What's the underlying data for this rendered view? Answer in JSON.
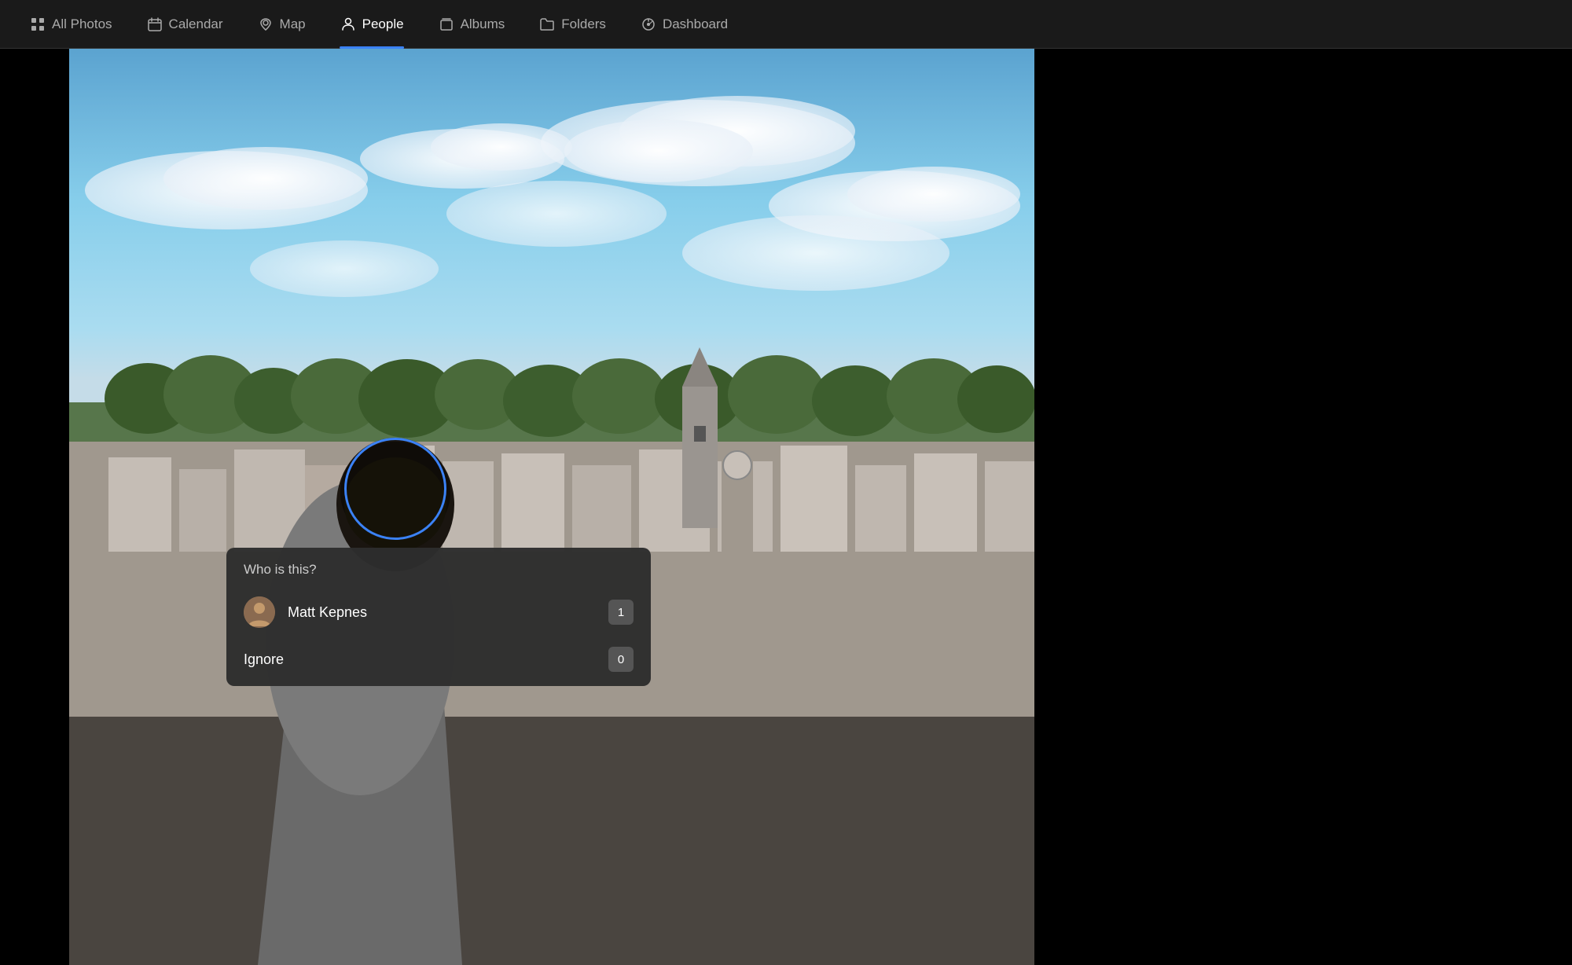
{
  "navbar": {
    "items": [
      {
        "id": "all-photos",
        "label": "All Photos",
        "icon": "grid-icon",
        "active": false
      },
      {
        "id": "calendar",
        "label": "Calendar",
        "icon": "calendar-icon",
        "active": false
      },
      {
        "id": "map",
        "label": "Map",
        "icon": "map-pin-icon",
        "active": false
      },
      {
        "id": "people",
        "label": "People",
        "icon": "person-icon",
        "active": true
      },
      {
        "id": "albums",
        "label": "Albums",
        "icon": "album-icon",
        "active": false
      },
      {
        "id": "folders",
        "label": "Folders",
        "icon": "folder-icon",
        "active": false
      },
      {
        "id": "dashboard",
        "label": "Dashboard",
        "icon": "dashboard-icon",
        "active": false
      }
    ]
  },
  "popup": {
    "title": "Who is this?",
    "suggestions": [
      {
        "name": "Matt Kepnes",
        "count": "1",
        "has_avatar": true
      }
    ],
    "ignore_label": "Ignore",
    "ignore_count": "0"
  },
  "colors": {
    "nav_bg": "#1a1a1a",
    "active_underline": "#3b82f6",
    "face_circle": "#3b82f6",
    "popup_bg": "#2d2d2d"
  }
}
